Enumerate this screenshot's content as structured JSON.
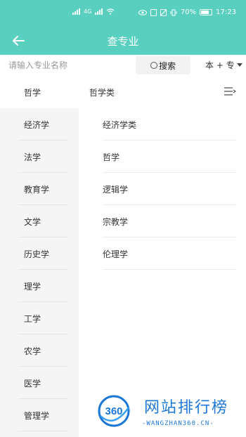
{
  "status_bar": {
    "signal_text": "4G",
    "battery": "70%",
    "time": "17:23"
  },
  "header": {
    "title": "查专业",
    "back_icon": "arrow-left-icon"
  },
  "search": {
    "placeholder": "请输入专业名称",
    "button_label": "搜索",
    "level_select": "本 + 专"
  },
  "categories": [
    {
      "label": "哲学",
      "active": true
    },
    {
      "label": "经济学"
    },
    {
      "label": "法学"
    },
    {
      "label": "教育学"
    },
    {
      "label": "文学"
    },
    {
      "label": "历史学"
    },
    {
      "label": "理学"
    },
    {
      "label": "工学"
    },
    {
      "label": "农学"
    },
    {
      "label": "医学"
    },
    {
      "label": "管理学"
    }
  ],
  "group": {
    "title": "哲学类",
    "items": [
      "经济学类",
      "哲学",
      "逻辑学",
      "宗教学",
      "伦理学"
    ]
  },
  "watermark": {
    "brand": "网站排行榜",
    "url": "-WANGZHAN360.CN-",
    "logo_text": "360"
  },
  "colors": {
    "accent": "#59cfc0",
    "watermark": "#1c78d6"
  }
}
